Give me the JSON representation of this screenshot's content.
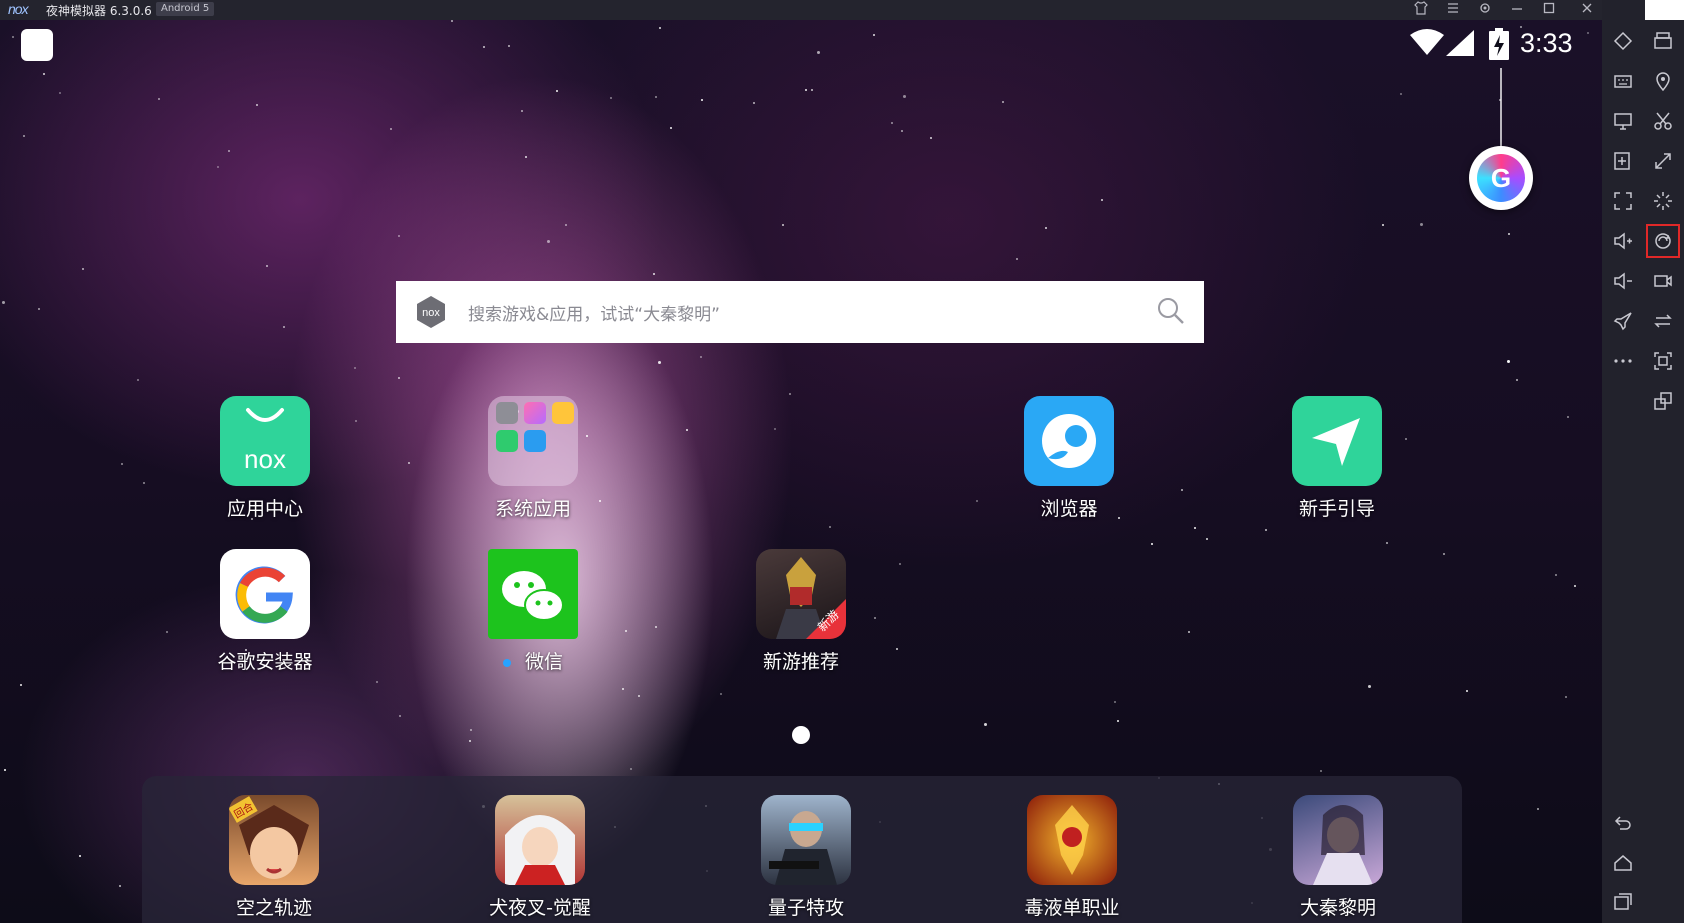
{
  "titlebar": {
    "logo": "nox",
    "title": "夜神模拟器 6.3.0.6",
    "android_version": "Android 5",
    "controls": [
      "shirt-icon",
      "menu-icon",
      "settings-icon",
      "minimize-icon",
      "maximize-icon",
      "close-icon",
      "collapse-icon"
    ]
  },
  "status_bar": {
    "time": "3:33",
    "icons": [
      "wifi-icon",
      "signal-icon",
      "battery-charging-icon"
    ]
  },
  "assistant": {
    "letter": "G"
  },
  "search": {
    "brand": "nox",
    "placeholder": "搜索游戏&应用，试试“大秦黎明”"
  },
  "apps": [
    {
      "label": "应用中心",
      "icon": "nox-app-center-icon"
    },
    {
      "label": "系统应用",
      "icon": "system-apps-folder-icon"
    },
    {
      "label": "浏览器",
      "icon": "browser-icon"
    },
    {
      "label": "新手引导",
      "icon": "guide-icon"
    },
    {
      "label": "谷歌安装器",
      "icon": "google-installer-icon"
    },
    {
      "label": "微信",
      "icon": "wechat-icon"
    },
    {
      "label": "新游推荐",
      "icon": "new-games-icon",
      "badge": "新游"
    }
  ],
  "app_center_brand": "nox",
  "dock": [
    {
      "label": "空之轨迹",
      "icon": "game-sky-trails-icon",
      "badge": "回合"
    },
    {
      "label": "犬夜叉-觉醒",
      "icon": "game-inuyasha-icon"
    },
    {
      "label": "量子特攻",
      "icon": "game-quantum-strike-icon"
    },
    {
      "label": "毒液单职业",
      "icon": "game-venom-icon"
    },
    {
      "label": "大秦黎明",
      "icon": "game-qin-dawn-icon"
    }
  ],
  "sidebar": {
    "left_column": [
      "diamond-icon",
      "keyboard-icon",
      "screen-icon",
      "apk-install-icon",
      "fullscreen-icon",
      "volume-up-icon",
      "volume-down-icon",
      "rocket-icon",
      "more-icon"
    ],
    "right_column": [
      "printer-icon",
      "location-icon",
      "scissors-icon",
      "resize-icon",
      "shake-icon",
      "sync-icon",
      "video-record-icon",
      "swap-icon",
      "screenshot-icon",
      "multi-window-icon"
    ],
    "highlighted": "sync-icon",
    "bottom": [
      "back-icon",
      "home-icon",
      "recents-icon"
    ]
  },
  "colors": {
    "titlebar": "#24242e",
    "sidebar": "#22222c",
    "nox_green": "#2fd49a",
    "browser_blue": "#2aa8f5",
    "wechat_green": "#1dc31d",
    "highlight_red": "#e02828"
  }
}
